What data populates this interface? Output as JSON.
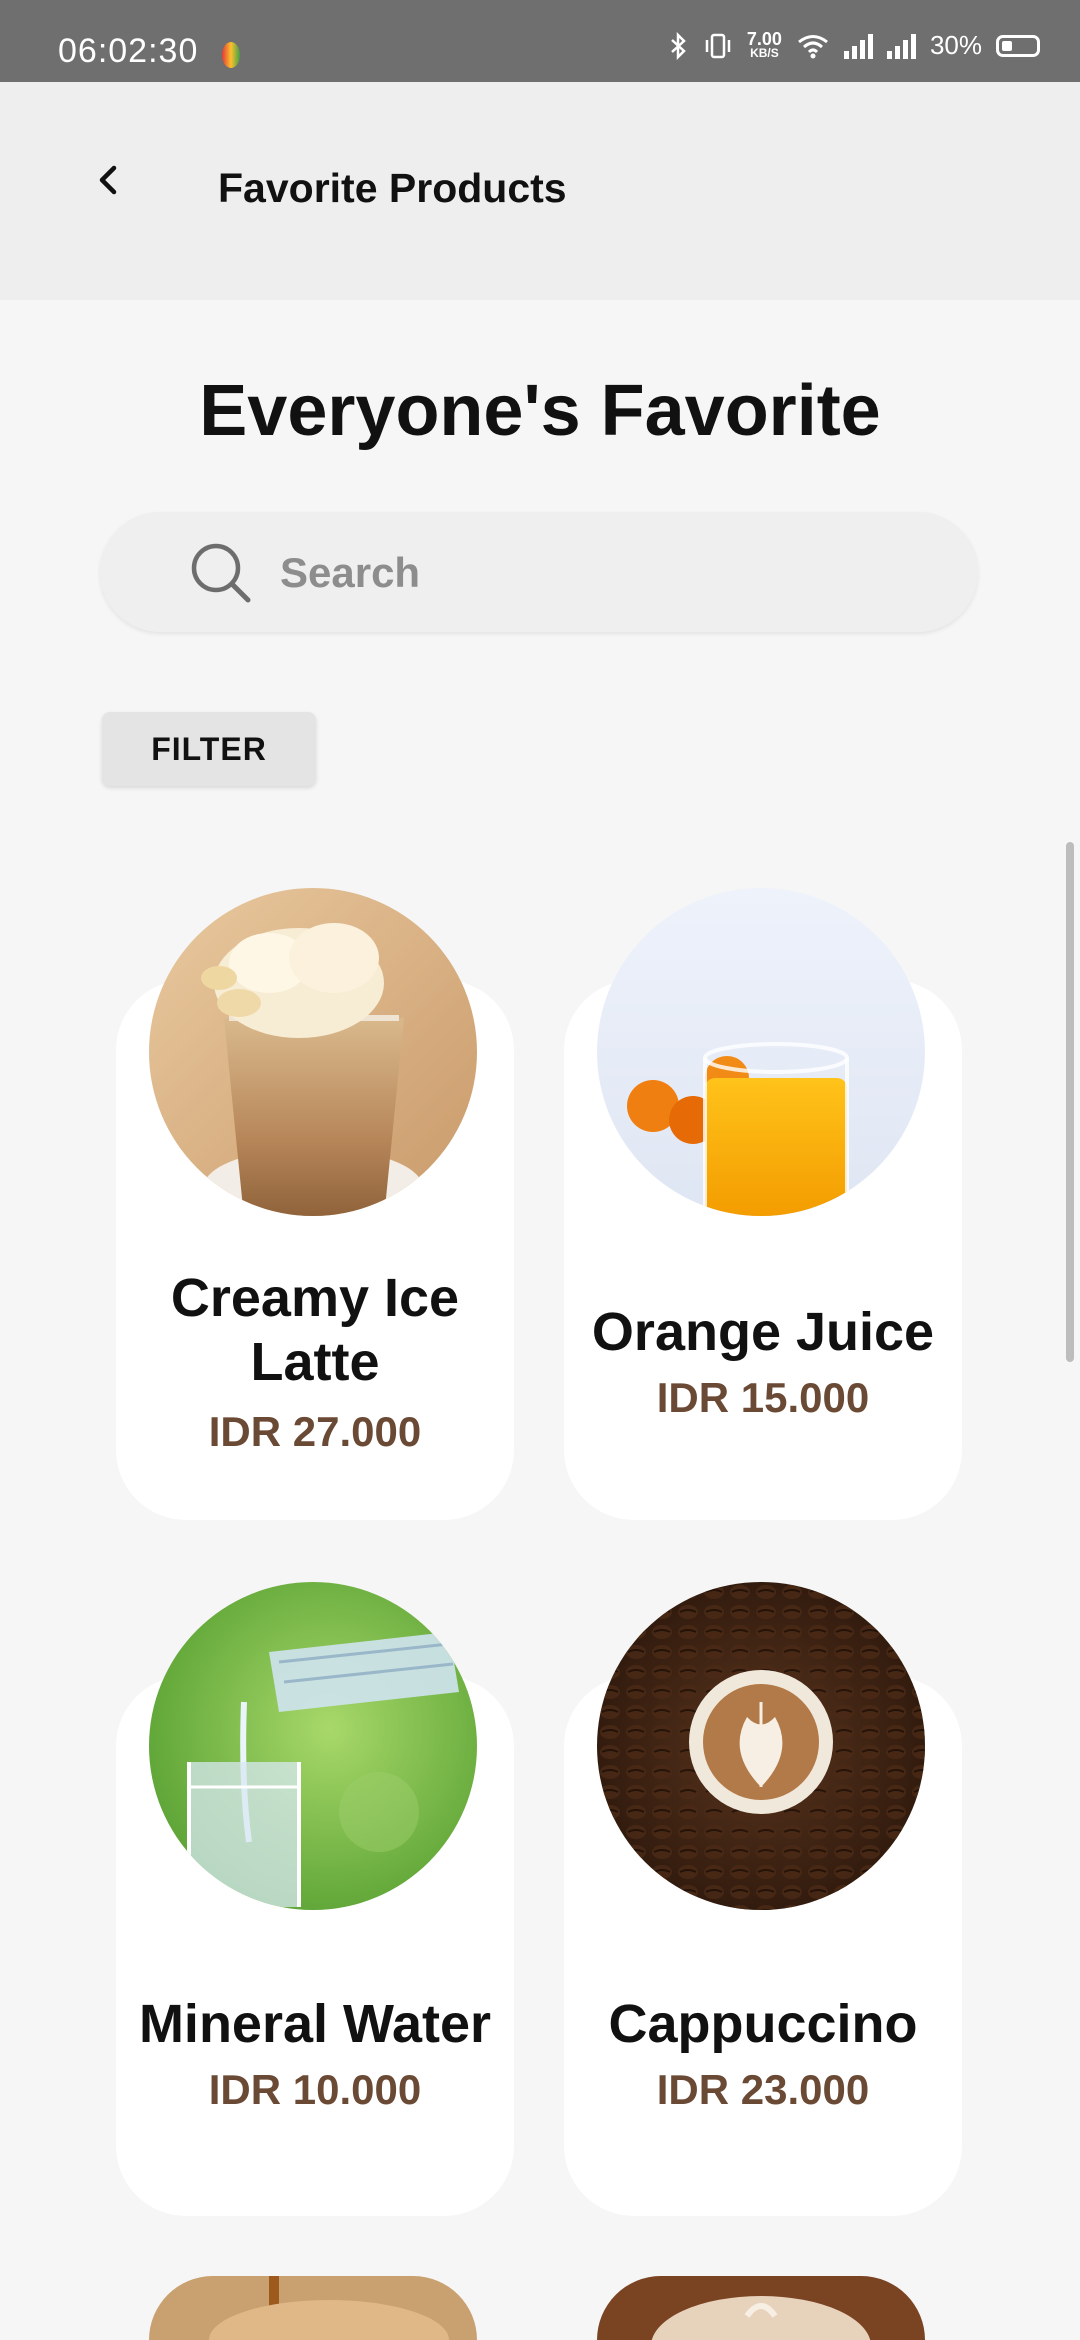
{
  "status": {
    "time": "06:02:30",
    "speed_value": "7.00",
    "speed_unit": "KB/S",
    "battery": "30%"
  },
  "appbar": {
    "title": "Favorite Products"
  },
  "page": {
    "heading": "Everyone's Favorite",
    "search_placeholder": "Search",
    "filter_label": "FILTER"
  },
  "products": [
    {
      "name": "Creamy Ice Latte",
      "price": "IDR 27.000"
    },
    {
      "name": "Orange Juice",
      "price": "IDR 15.000"
    },
    {
      "name": "Mineral Water",
      "price": "IDR 10.000"
    },
    {
      "name": "Cappuccino",
      "price": "IDR 23.000"
    }
  ],
  "colors": {
    "price": "#6b4a35",
    "appbar": "#eeeeee",
    "statusbar": "#6f6f6f"
  }
}
